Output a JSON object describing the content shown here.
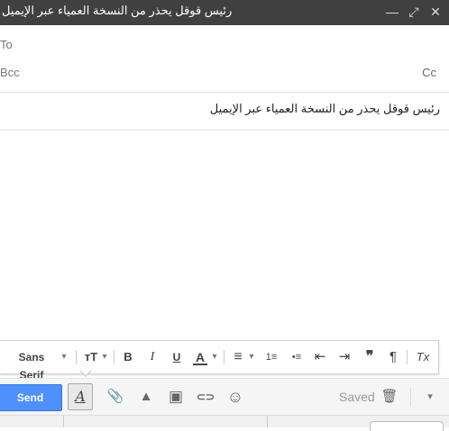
{
  "window": {
    "title": "رئيس قوقل يحذر من النسخة العمياء عبر الإيميل",
    "minimize_glyph": "—",
    "expand_glyph": "⤢",
    "close_glyph": "✕"
  },
  "recipients": {
    "to_label": "To",
    "bcc_label": "Bcc",
    "cc_label": "Cc"
  },
  "subject": "رئيس قوقل يحذر من النسخة العمياء عبر الإيميل",
  "format_toolbar": {
    "font_name": "Sans Serif",
    "dropdown_glyph": "▾",
    "size_glyph": "тT",
    "bold_glyph": "B",
    "italic_glyph": "I",
    "underline_glyph": "U",
    "text_color_glyph": "A",
    "align_glyph": "≡",
    "numbered_list_glyph": "1≡",
    "bulleted_list_glyph": "•≡",
    "indent_less_glyph": "⇤",
    "indent_more_glyph": "⇥",
    "quote_glyph": "❞",
    "rtl_glyph": "¶",
    "clear_format_glyph": "Tx"
  },
  "bottom_bar": {
    "send_label": "Send",
    "format_toggle_glyph": "A",
    "attach_glyph": "📎",
    "drive_glyph": "▲",
    "photo_glyph": "▣",
    "link_glyph": "⊂⊃",
    "emoji_glyph": "☺",
    "saved_label": "Saved",
    "trash_glyph": "🗑",
    "more_glyph": "▾"
  },
  "colors": {
    "titlebar": "#404040",
    "send_button": "#4d90fe"
  }
}
